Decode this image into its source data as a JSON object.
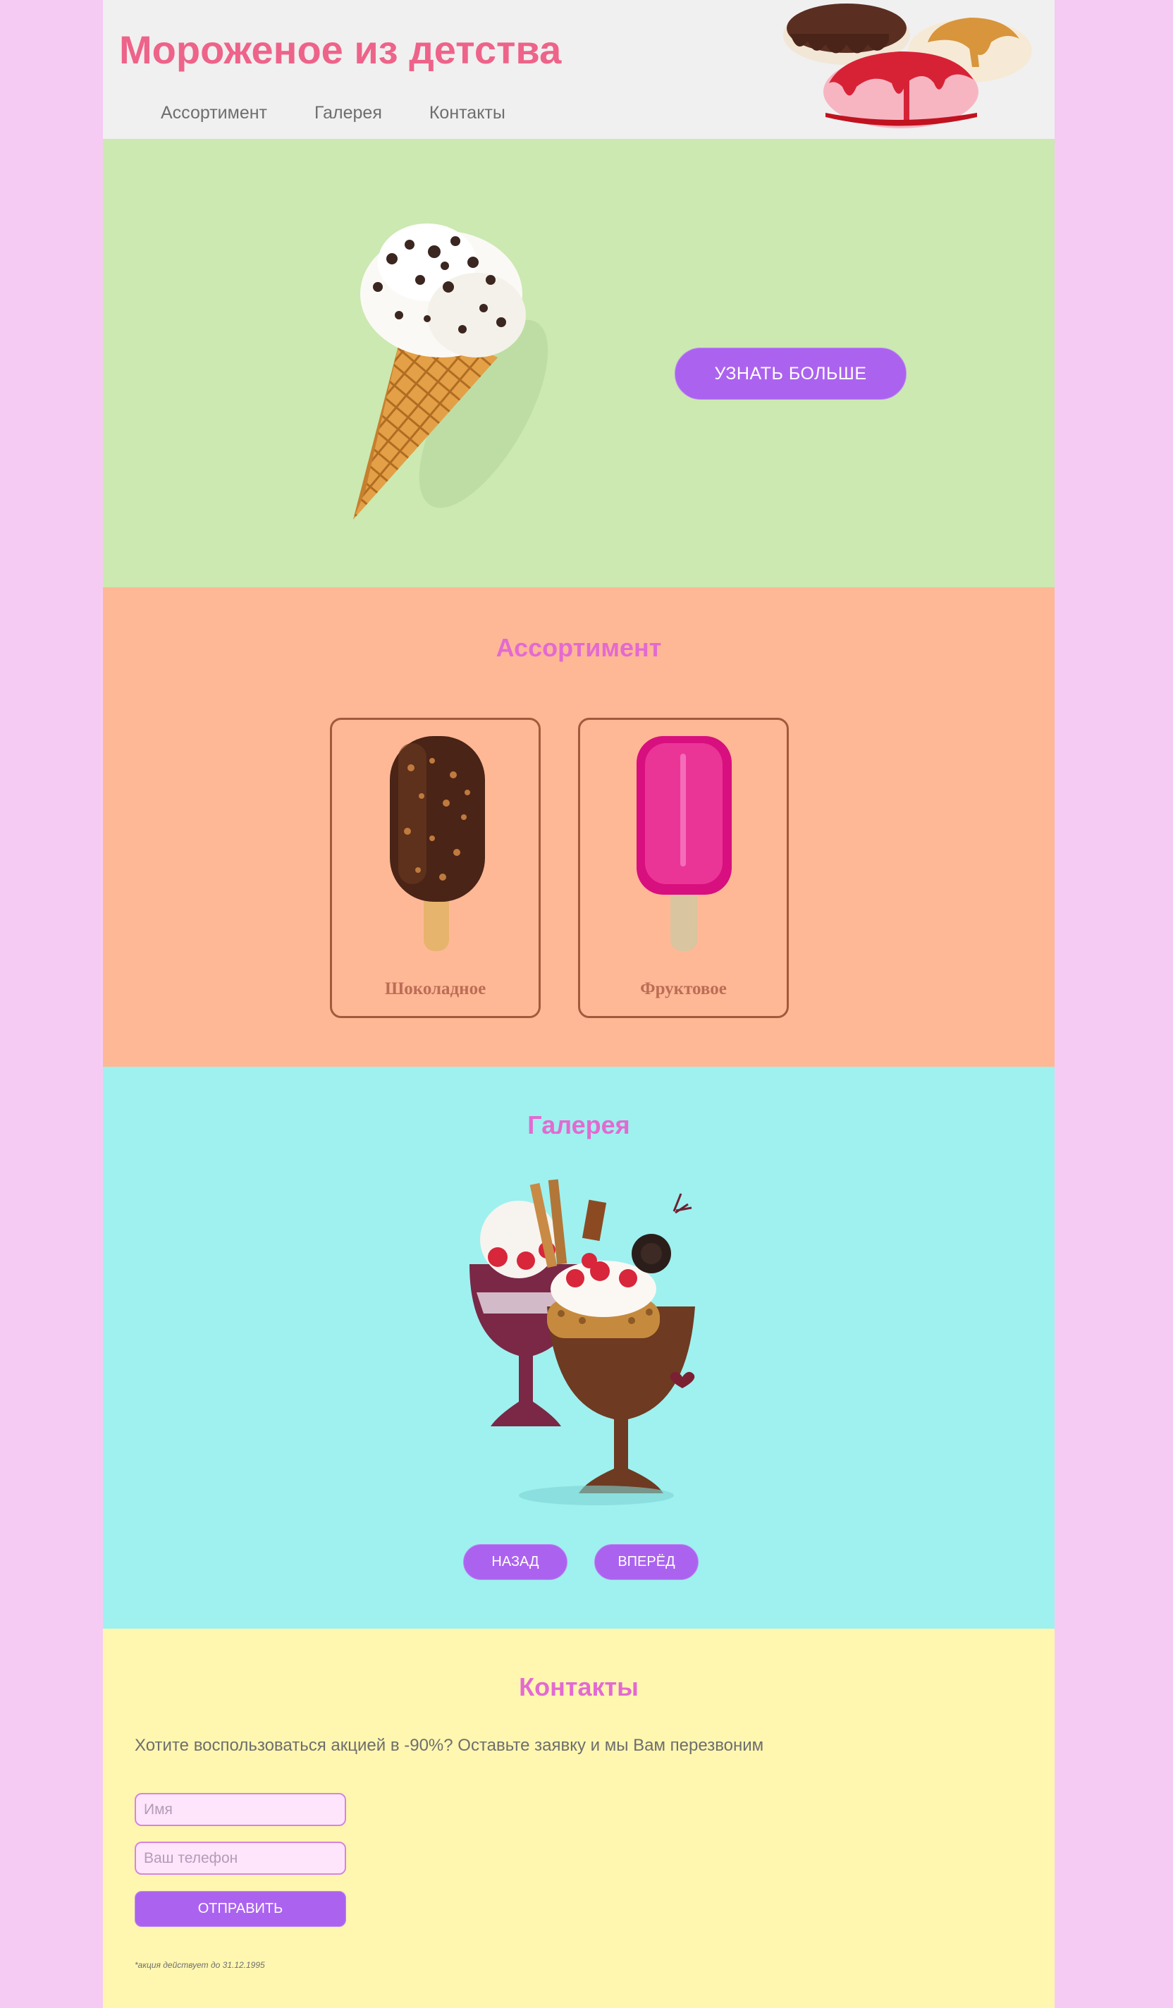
{
  "header": {
    "title": "Мороженое из детства",
    "nav": [
      "Ассортимент",
      "Галерея",
      "Контакты"
    ]
  },
  "hero": {
    "button": "УЗНАТЬ БОЛЬШЕ"
  },
  "assortment": {
    "title": "Ассортимент",
    "items": [
      "Шоколадное",
      "Фруктовое"
    ]
  },
  "gallery": {
    "title": "Галерея",
    "prev": "НАЗАД",
    "next": "ВПЕРЁД"
  },
  "contacts": {
    "title": "Контакты",
    "promo": "Хотите воспользоваться акцией в -90%? Оставьте заявку и мы Вам перезвоним",
    "name_placeholder": "Имя",
    "phone_placeholder": "Ваш телефон",
    "submit": "ОТПРАВИТЬ",
    "note": "*акция действует до 31.12.1995"
  },
  "colors": {
    "page_bg": "#f6cbf3",
    "header_bg": "#f0f0f0",
    "hero_bg": "#cbe9b1",
    "assortment_bg": "#ffb896",
    "gallery_bg": "#9ef1ef",
    "contacts_bg": "#fff7b0",
    "title_pink": "#ee6389",
    "section_title": "#e36ad1",
    "button": "#ab63ef"
  },
  "icons": [
    "ice-cream-scoops-image",
    "cone-ice-cream-image",
    "chocolate-popsicle-image",
    "fruit-popsicle-image",
    "sundae-image"
  ]
}
